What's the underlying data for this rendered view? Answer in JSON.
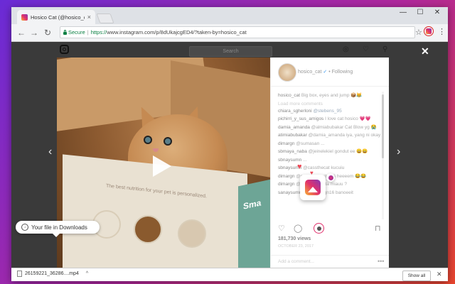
{
  "browser": {
    "tab_title": "Hosico Cat (@hosico_cat)",
    "tab_close": "×",
    "secure_label": "Secure",
    "url_scheme": "https://",
    "url_rest": "www.instagram.com/p/8dUkajcgED4/?taken-by=hosico_cat",
    "window_controls": [
      "—",
      "☐",
      "✕"
    ]
  },
  "instagram": {
    "search_placeholder": "Search",
    "close_label": "✕",
    "prev_arrow": "‹",
    "next_arrow": "›",
    "post": {
      "username": "hosico_cat",
      "verified_mark": "✓",
      "follow_status": "• Following",
      "caption_user": "hosico_cat",
      "caption_text": "Big box, eyes and jump 📦😹",
      "load_more": "Load more comments",
      "comments": [
        {
          "user": "chiara_sgherloni",
          "text": "@stebens_95"
        },
        {
          "user": "pichirri_y_sus_amigos",
          "text": "I love cat hosico 💗💗"
        },
        {
          "user": "damia_amanda",
          "text": "@almiabubakar Cat Blow yg 😭"
        },
        {
          "user": "atimiabubakar",
          "text": "@damia_amanda iya, yang ni okay"
        },
        {
          "user": "dimargn",
          "text": "@sumasan ..."
        },
        {
          "user": "sbmaya_naba",
          "text": "@jeinelekiel gondut ee 😄😄"
        },
        {
          "user": "sbnaysumn",
          "text": "..."
        },
        {
          "user": "sbnaysumn",
          "text": "@cassthecat kucuiu"
        },
        {
          "user": "dimargn",
          "text": "@sanaysumnita 16 heeeem 😂😂"
        },
        {
          "user": "dimargn",
          "text": "@sanaysumnita miauu ?"
        },
        {
          "user": "sanaysumnita",
          "text": "@dimargn16 banoeeit"
        }
      ],
      "views": "181,730 views",
      "date": "OCTOBER 23, 2017",
      "add_comment_placeholder": "Add a comment...",
      "more_label": "•••"
    },
    "box_text": "The best nutrition for your pet is personalized.",
    "box_brand": "Sma"
  },
  "tooltip": {
    "text": "Your file in Downloads"
  },
  "downloads": {
    "filename": "26159221_36286....mp4",
    "caret": "^",
    "show_all": "Show all",
    "close": "✕"
  },
  "colors": {
    "accent": "#e1306c",
    "secure": "#0b8043",
    "heart": "#ed4956"
  }
}
